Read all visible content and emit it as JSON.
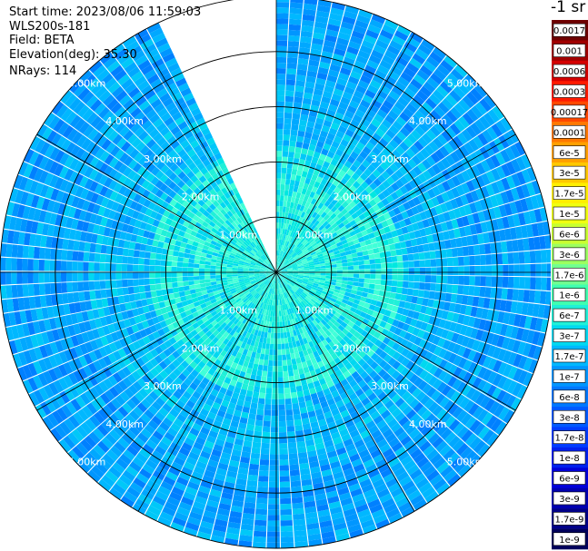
{
  "header": {
    "start_time": "Start time: 2023/08/06 11:59:03",
    "instrument": "WLS200s-181",
    "field": "Field: BETA",
    "elevation": "Elevation(deg): 35.30",
    "nrays": "NRays: 114"
  },
  "colorbar": {
    "unit": "-1 sr",
    "labels": [
      "0.0017",
      "0.001",
      "0.0006",
      "0.0003",
      "0.00017",
      "0.0001",
      "6e-5",
      "3e-5",
      "1.7e-5",
      "1e-5",
      "6e-6",
      "3e-6",
      "1.7e-6",
      "1e-6",
      "6e-7",
      "3e-7",
      "1.7e-7",
      "1e-7",
      "6e-8",
      "3e-8",
      "1.7e-8",
      "1e-8",
      "6e-9",
      "3e-9",
      "1.7e-9",
      "1e-9"
    ],
    "colors": [
      "#6e0000",
      "#a00000",
      "#d40000",
      "#ff1a00",
      "#ff4800",
      "#ff7800",
      "#ffa000",
      "#ffc800",
      "#ffee00",
      "#f0ff10",
      "#c8ff30",
      "#9cff60",
      "#70ff90",
      "#40ffb0",
      "#20f0d8",
      "#00d8f0",
      "#00b8ff",
      "#0096ff",
      "#0078ff",
      "#005aff",
      "#003cff",
      "#0020ee",
      "#0000d8",
      "#0000b0",
      "#000088",
      "#00005c"
    ]
  },
  "chart_data": {
    "type": "ppi",
    "field": "BETA",
    "elevation_deg": 35.3,
    "nrays": 114,
    "max_range_km": 5.0,
    "azimuth_gap_deg": [
      335,
      360
    ],
    "range_rings_km": [
      1,
      2,
      3,
      4,
      5
    ],
    "ring_labels": [
      "1.00km",
      "2.00km",
      "3.00km",
      "4.00km",
      "5.00km"
    ],
    "radial_lines_deg": [
      0,
      30,
      60,
      90,
      120,
      150,
      180,
      210,
      240,
      270,
      300,
      330
    ],
    "grid": true
  }
}
